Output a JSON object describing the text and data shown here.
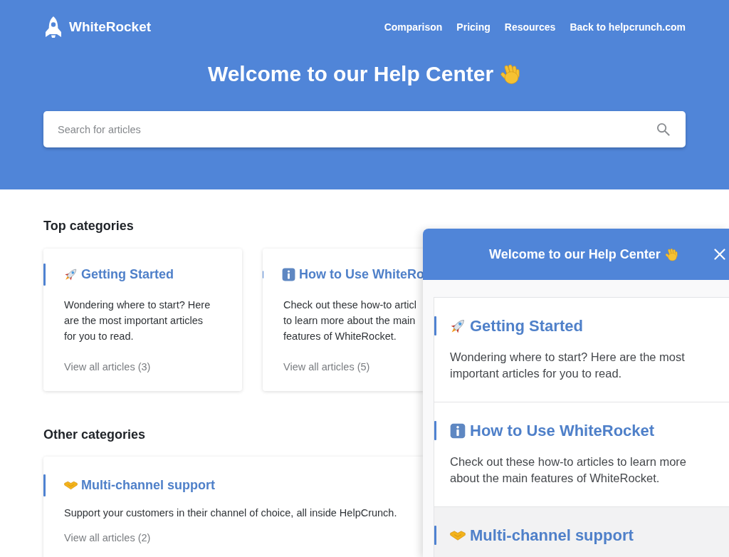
{
  "header": {
    "brand": "WhiteRocket",
    "nav": [
      "Comparison",
      "Pricing",
      "Resources",
      "Back to helpcrunch.com"
    ],
    "title": "Welcome to our Help Center",
    "search": {
      "placeholder": "Search for articles"
    }
  },
  "top_categories": {
    "heading": "Top categories",
    "cards": [
      {
        "kind": "rocket",
        "title": "Getting Started",
        "description": "Wondering where to start? Here are the most important articles for you to read.",
        "link": "View all articles (3)"
      },
      {
        "kind": "info",
        "title": "How to Use WhiteRo",
        "description": "Check out these how-to articl to learn more about the main features of WhiteRocket.",
        "link": "View all articles (5)"
      }
    ]
  },
  "other_categories": {
    "heading": "Other categories",
    "cards": [
      {
        "kind": "handshake",
        "title": "Multi-channel support",
        "description": "Support your customers in their channel of choice, all inside HelpCrunch.",
        "link": "View all articles (2)"
      }
    ]
  },
  "widget": {
    "title": "Welcome to our Help Center",
    "items": [
      {
        "kind": "rocket",
        "title": "Getting Started",
        "description": "Wondering where to start? Here are the most important articles for you to read.",
        "highlighted": false
      },
      {
        "kind": "info",
        "title": "How to Use WhiteRocket",
        "description": "Check out these how-to articles to learn more about the main features of WhiteRocket.",
        "highlighted": false
      },
      {
        "kind": "handshake",
        "title": "Multi-channel support",
        "highlighted": true
      }
    ]
  }
}
